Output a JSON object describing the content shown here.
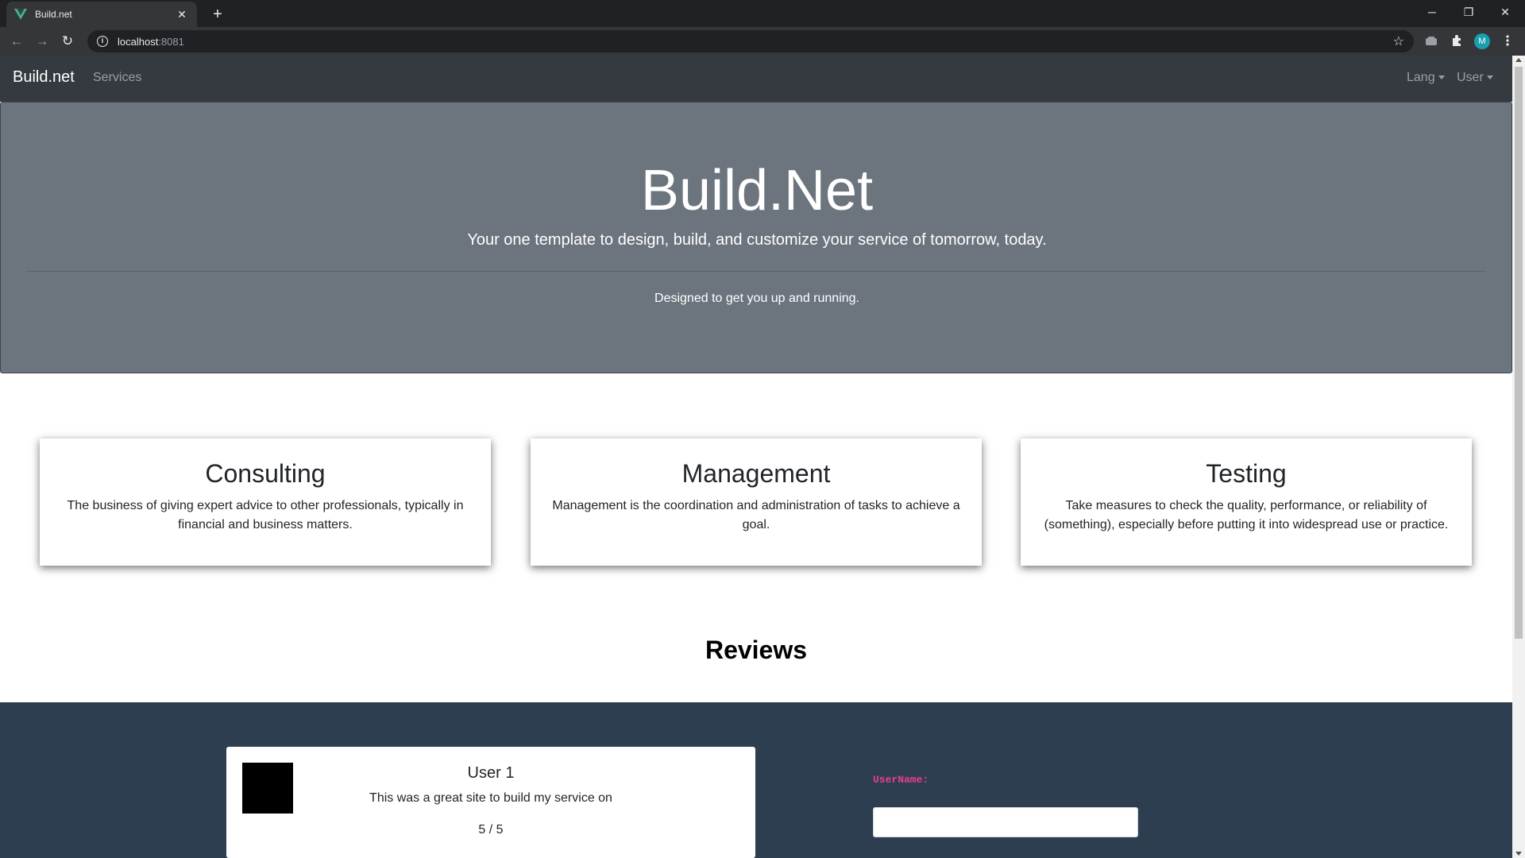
{
  "browser": {
    "tab_title": "Build.net",
    "tab_close": "✕",
    "new_tab": "+",
    "url_host": "localhost",
    "url_port": ":8081",
    "window": {
      "minimize": "─",
      "restore": "❐",
      "close": "✕"
    },
    "nav": {
      "back": "←",
      "forward": "→",
      "reload": "↻"
    },
    "info_glyph": "i",
    "star": "☆",
    "avatar_initial": "M"
  },
  "site_nav": {
    "brand": "Build.net",
    "services": "Services",
    "lang": "Lang",
    "user": "User"
  },
  "hero": {
    "title": "Build.Net",
    "lead": "Your one template to design, build, and customize your service of tomorrow, today.",
    "text": "Designed to get you up and running."
  },
  "services": [
    {
      "title": "Consulting",
      "text": "The business of giving expert advice to other professionals, typically in financial and business matters."
    },
    {
      "title": "Management",
      "text": "Management is the coordination and administration of tasks to achieve a goal."
    },
    {
      "title": "Testing",
      "text": "Take measures to check the quality, performance, or reliability of (something), especially before putting it into widespread use or practice."
    }
  ],
  "reviews": {
    "heading": "Reviews",
    "items": [
      {
        "user": "User 1",
        "text": "This was a great site to build my service on",
        "score": "5 / 5"
      }
    ],
    "form": {
      "username_label": "UserName:",
      "username_value": ""
    }
  },
  "colors": {
    "navbar": "#343a40",
    "jumbotron": "#6c757d",
    "reviews_band": "#2c3e50",
    "label_pink": "#e83e8c"
  }
}
